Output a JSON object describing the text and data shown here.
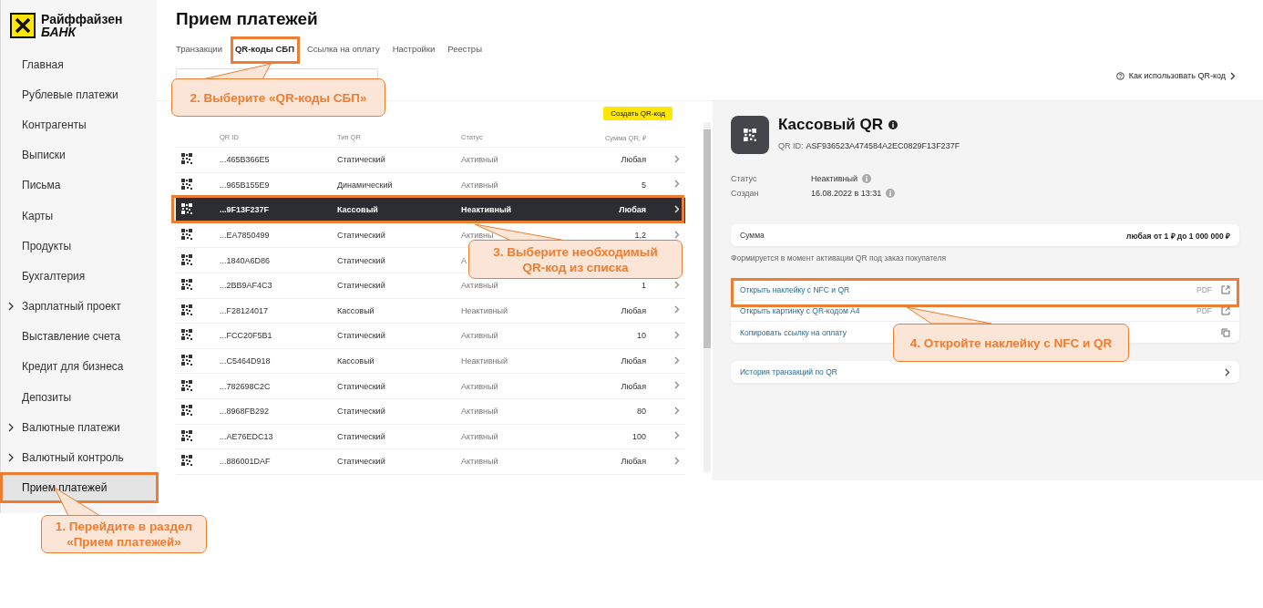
{
  "logo": {
    "line_1": "Райффайзен",
    "line_2": "БАНК"
  },
  "sidebar": {
    "items": [
      {
        "label": "Главная",
        "expandable": false,
        "selected": false
      },
      {
        "label": "Рублевые платежи",
        "expandable": false,
        "selected": false
      },
      {
        "label": "Контрагенты",
        "expandable": false,
        "selected": false
      },
      {
        "label": "Выписки",
        "expandable": false,
        "selected": false
      },
      {
        "label": "Письма",
        "expandable": false,
        "selected": false
      },
      {
        "label": "Карты",
        "expandable": false,
        "selected": false
      },
      {
        "label": "Продукты",
        "expandable": false,
        "selected": false
      },
      {
        "label": "Бухгалтерия",
        "expandable": false,
        "selected": false
      },
      {
        "label": "Зарплатный проект",
        "expandable": true,
        "selected": false
      },
      {
        "label": "Выставление счета",
        "expandable": false,
        "selected": false
      },
      {
        "label": "Кредит для бизнеса",
        "expandable": false,
        "selected": false
      },
      {
        "label": "Депозиты",
        "expandable": false,
        "selected": false
      },
      {
        "label": "Валютные платежи",
        "expandable": true,
        "selected": false
      },
      {
        "label": "Валютный контроль",
        "expandable": true,
        "selected": false
      },
      {
        "label": "Прием платежей",
        "expandable": false,
        "selected": true
      }
    ]
  },
  "page_title": "Прием платежей",
  "tabs": [
    {
      "label": "Транзакции",
      "selected": false
    },
    {
      "label": "QR-коды СБП",
      "selected": true
    },
    {
      "label": "Ссылка на оплату",
      "selected": false
    },
    {
      "label": "Настройки",
      "selected": false
    },
    {
      "label": "Реестры",
      "selected": false
    }
  ],
  "help_link": "Как использовать QR-код",
  "create_button": "Создать QR-код",
  "table": {
    "columns": [
      "QR ID",
      "Тип QR",
      "Статус",
      "Сумма QR, ₽"
    ],
    "rows": [
      {
        "id": "...465B366E5",
        "type": "Статический",
        "status": "Активный",
        "amount": "Любая",
        "selected": false
      },
      {
        "id": "...965B155E9",
        "type": "Динамический",
        "status": "Активный",
        "amount": "5",
        "selected": false
      },
      {
        "id": "...9F13F237F",
        "type": "Кассовый",
        "status": "Неактивный",
        "amount": "Любая",
        "selected": true
      },
      {
        "id": "...EA7850499",
        "type": "Статический",
        "status": "Активны",
        "amount": "1,2",
        "selected": false
      },
      {
        "id": "...1840A6D86",
        "type": "Статический",
        "status": "А",
        "selected": false
      },
      {
        "id": "...2BB9AF4C3",
        "type": "Статический",
        "status": "Активный",
        "amount": "1",
        "selected": false
      },
      {
        "id": "...F28124017",
        "type": "Кассовый",
        "status": "Неактивный",
        "amount": "Любая",
        "selected": false
      },
      {
        "id": "...FCC20F5B1",
        "type": "Статический",
        "status": "Активный",
        "amount": "10",
        "selected": false
      },
      {
        "id": "...C5464D918",
        "type": "Кассовый",
        "status": "Неактивный",
        "amount": "Любая",
        "selected": false
      },
      {
        "id": "...782698C2C",
        "type": "Статический",
        "status": "Активный",
        "amount": "Любая",
        "selected": false
      },
      {
        "id": "...8968FB292",
        "type": "Статический",
        "status": "Активный",
        "amount": "80",
        "selected": false
      },
      {
        "id": "...AE76EDC13",
        "type": "Статический",
        "status": "Активный",
        "amount": "100",
        "selected": false
      },
      {
        "id": "...886001DAF",
        "type": "Статический",
        "status": "Активный",
        "amount": "Любая",
        "selected": false
      }
    ]
  },
  "detail": {
    "title": "Кассовый QR",
    "qr_id_label": "QR ID:",
    "qr_id": "ASF936523A474584A2EC0829F13F237F",
    "fields": [
      {
        "label": "Статус",
        "value": "Неактивный"
      },
      {
        "label": "Создан",
        "value": "16.08.2022 в 13:31"
      }
    ],
    "sum": {
      "label": "Сумма",
      "value": "любая от 1 ₽ до 1 000 000 ₽"
    },
    "sum_note": "Формируется в момент активации QR под заказ покупателя",
    "actions": [
      {
        "label": "Открыть наклейку с NFC и QR",
        "format": "PDF",
        "kind": "external"
      },
      {
        "label": "Открыть картинку с QR-кодом А4",
        "format": "PDF",
        "kind": "external"
      },
      {
        "label": "Копировать ссылку на оплату",
        "kind": "copy"
      }
    ],
    "history_link": "История транзакций по QR"
  },
  "annotations": [
    {
      "text": "1. Перейдите в раздел «Прием платежей»"
    },
    {
      "text": "2. Выберите «QR-коды СБП»"
    },
    {
      "text": "3. Выберите необходимый QR-код из списка"
    },
    {
      "text": "4. Откройте наклейку с NFC и QR"
    }
  ]
}
